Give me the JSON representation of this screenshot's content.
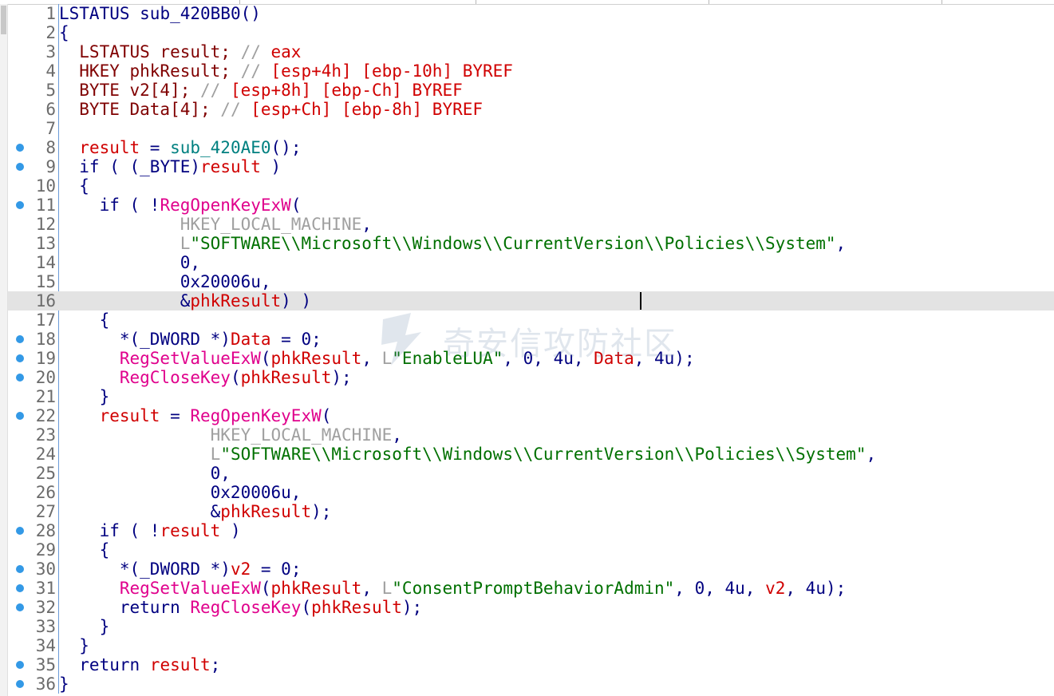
{
  "colors": {
    "keyword": "#000080",
    "type": "#800000",
    "variable": "#d00000",
    "function": "#e0008c",
    "local_function": "#008080",
    "string": "#007000",
    "number": "#000080",
    "comment": "#a0a0a0",
    "constant": "#a0a0a0",
    "line_number": "#6b6b6b",
    "breakpoint_dot": "#3399e6"
  },
  "watermark": {
    "text": "奇安信攻防社区"
  },
  "editor": {
    "current_line": 16,
    "lines": [
      {
        "n": "1",
        "dot": false,
        "tokens": [
          {
            "t": "LSTATUS",
            "c": "keyword"
          },
          {
            "t": " sub_420BB0()",
            "c": "keyword"
          }
        ]
      },
      {
        "n": "2",
        "dot": false,
        "tokens": [
          {
            "t": "{",
            "c": "keyword"
          }
        ]
      },
      {
        "n": "3",
        "dot": false,
        "tokens": [
          {
            "t": "  LSTATUS result; ",
            "c": "type"
          },
          {
            "t": "// ",
            "c": "comment"
          },
          {
            "t": "eax",
            "c": "variable"
          }
        ]
      },
      {
        "n": "4",
        "dot": false,
        "tokens": [
          {
            "t": "  HKEY phkResult; ",
            "c": "type"
          },
          {
            "t": "// ",
            "c": "comment"
          },
          {
            "t": "[esp+4h] [ebp-10h] BYREF",
            "c": "variable"
          }
        ]
      },
      {
        "n": "5",
        "dot": false,
        "tokens": [
          {
            "t": "  BYTE v2[4]; ",
            "c": "type"
          },
          {
            "t": "// ",
            "c": "comment"
          },
          {
            "t": "[esp+8h] [ebp-Ch] BYREF",
            "c": "variable"
          }
        ]
      },
      {
        "n": "6",
        "dot": false,
        "tokens": [
          {
            "t": "  BYTE Data[4]; ",
            "c": "type"
          },
          {
            "t": "// ",
            "c": "comment"
          },
          {
            "t": "[esp+Ch] [ebp-8h] BYREF",
            "c": "variable"
          }
        ]
      },
      {
        "n": "7",
        "dot": false,
        "tokens": []
      },
      {
        "n": "8",
        "dot": true,
        "tokens": [
          {
            "t": "  ",
            "c": "keyword"
          },
          {
            "t": "result",
            "c": "variable"
          },
          {
            "t": " = ",
            "c": "keyword"
          },
          {
            "t": "sub_420AE0",
            "c": "local_function"
          },
          {
            "t": "();",
            "c": "keyword"
          }
        ]
      },
      {
        "n": "9",
        "dot": true,
        "tokens": [
          {
            "t": "  if ( (",
            "c": "keyword"
          },
          {
            "t": "_BYTE",
            "c": "keyword"
          },
          {
            "t": ")",
            "c": "keyword"
          },
          {
            "t": "result",
            "c": "variable"
          },
          {
            "t": " )",
            "c": "keyword"
          }
        ]
      },
      {
        "n": "10",
        "dot": false,
        "tokens": [
          {
            "t": "  {",
            "c": "keyword"
          }
        ]
      },
      {
        "n": "11",
        "dot": true,
        "tokens": [
          {
            "t": "    if ( !",
            "c": "keyword"
          },
          {
            "t": "RegOpenKeyExW",
            "c": "function"
          },
          {
            "t": "(",
            "c": "keyword"
          }
        ]
      },
      {
        "n": "12",
        "dot": false,
        "tokens": [
          {
            "t": "            ",
            "c": "keyword"
          },
          {
            "t": "HKEY_LOCAL_MACHINE",
            "c": "constant"
          },
          {
            "t": ",",
            "c": "keyword"
          }
        ]
      },
      {
        "n": "13",
        "dot": false,
        "tokens": [
          {
            "t": "            ",
            "c": "keyword"
          },
          {
            "t": "L",
            "c": "comment"
          },
          {
            "t": "\"SOFTWARE\\\\Microsoft\\\\Windows\\\\CurrentVersion\\\\Policies\\\\System\"",
            "c": "string"
          },
          {
            "t": ",",
            "c": "keyword"
          }
        ]
      },
      {
        "n": "14",
        "dot": false,
        "tokens": [
          {
            "t": "            0,",
            "c": "number"
          }
        ]
      },
      {
        "n": "15",
        "dot": false,
        "tokens": [
          {
            "t": "            0x20006u,",
            "c": "number"
          }
        ]
      },
      {
        "n": "16",
        "dot": false,
        "tokens": [
          {
            "t": "            &",
            "c": "keyword"
          },
          {
            "t": "phkResult",
            "c": "variable"
          },
          {
            "t": ") )",
            "c": "keyword"
          }
        ]
      },
      {
        "n": "17",
        "dot": false,
        "tokens": [
          {
            "t": "    {",
            "c": "keyword"
          }
        ]
      },
      {
        "n": "18",
        "dot": true,
        "tokens": [
          {
            "t": "      *(",
            "c": "keyword"
          },
          {
            "t": "_DWORD",
            "c": "keyword"
          },
          {
            "t": " *)",
            "c": "keyword"
          },
          {
            "t": "Data",
            "c": "variable"
          },
          {
            "t": " = 0;",
            "c": "keyword"
          }
        ]
      },
      {
        "n": "19",
        "dot": true,
        "tokens": [
          {
            "t": "      ",
            "c": "keyword"
          },
          {
            "t": "RegSetValueExW",
            "c": "function"
          },
          {
            "t": "(",
            "c": "keyword"
          },
          {
            "t": "phkResult",
            "c": "variable"
          },
          {
            "t": ", ",
            "c": "keyword"
          },
          {
            "t": "L",
            "c": "comment"
          },
          {
            "t": "\"EnableLUA\"",
            "c": "string"
          },
          {
            "t": ", 0, 4u, ",
            "c": "keyword"
          },
          {
            "t": "Data",
            "c": "variable"
          },
          {
            "t": ", 4u);",
            "c": "keyword"
          }
        ]
      },
      {
        "n": "20",
        "dot": true,
        "tokens": [
          {
            "t": "      ",
            "c": "keyword"
          },
          {
            "t": "RegCloseKey",
            "c": "function"
          },
          {
            "t": "(",
            "c": "keyword"
          },
          {
            "t": "phkResult",
            "c": "variable"
          },
          {
            "t": ");",
            "c": "keyword"
          }
        ]
      },
      {
        "n": "21",
        "dot": false,
        "tokens": [
          {
            "t": "    }",
            "c": "keyword"
          }
        ]
      },
      {
        "n": "22",
        "dot": true,
        "tokens": [
          {
            "t": "    ",
            "c": "keyword"
          },
          {
            "t": "result",
            "c": "variable"
          },
          {
            "t": " = ",
            "c": "keyword"
          },
          {
            "t": "RegOpenKeyExW",
            "c": "function"
          },
          {
            "t": "(",
            "c": "keyword"
          }
        ]
      },
      {
        "n": "23",
        "dot": false,
        "tokens": [
          {
            "t": "               ",
            "c": "keyword"
          },
          {
            "t": "HKEY_LOCAL_MACHINE",
            "c": "constant"
          },
          {
            "t": ",",
            "c": "keyword"
          }
        ]
      },
      {
        "n": "24",
        "dot": false,
        "tokens": [
          {
            "t": "               ",
            "c": "keyword"
          },
          {
            "t": "L",
            "c": "comment"
          },
          {
            "t": "\"SOFTWARE\\\\Microsoft\\\\Windows\\\\CurrentVersion\\\\Policies\\\\System\"",
            "c": "string"
          },
          {
            "t": ",",
            "c": "keyword"
          }
        ]
      },
      {
        "n": "25",
        "dot": false,
        "tokens": [
          {
            "t": "               0,",
            "c": "number"
          }
        ]
      },
      {
        "n": "26",
        "dot": false,
        "tokens": [
          {
            "t": "               0x20006u,",
            "c": "number"
          }
        ]
      },
      {
        "n": "27",
        "dot": false,
        "tokens": [
          {
            "t": "               &",
            "c": "keyword"
          },
          {
            "t": "phkResult",
            "c": "variable"
          },
          {
            "t": ");",
            "c": "keyword"
          }
        ]
      },
      {
        "n": "28",
        "dot": true,
        "tokens": [
          {
            "t": "    if ( !",
            "c": "keyword"
          },
          {
            "t": "result",
            "c": "variable"
          },
          {
            "t": " )",
            "c": "keyword"
          }
        ]
      },
      {
        "n": "29",
        "dot": false,
        "tokens": [
          {
            "t": "    {",
            "c": "keyword"
          }
        ]
      },
      {
        "n": "30",
        "dot": true,
        "tokens": [
          {
            "t": "      *(",
            "c": "keyword"
          },
          {
            "t": "_DWORD",
            "c": "keyword"
          },
          {
            "t": " *)",
            "c": "keyword"
          },
          {
            "t": "v2",
            "c": "variable"
          },
          {
            "t": " = 0;",
            "c": "keyword"
          }
        ]
      },
      {
        "n": "31",
        "dot": true,
        "tokens": [
          {
            "t": "      ",
            "c": "keyword"
          },
          {
            "t": "RegSetValueExW",
            "c": "function"
          },
          {
            "t": "(",
            "c": "keyword"
          },
          {
            "t": "phkResult",
            "c": "variable"
          },
          {
            "t": ", ",
            "c": "keyword"
          },
          {
            "t": "L",
            "c": "comment"
          },
          {
            "t": "\"ConsentPromptBehaviorAdmin\"",
            "c": "string"
          },
          {
            "t": ", 0, 4u, ",
            "c": "keyword"
          },
          {
            "t": "v2",
            "c": "variable"
          },
          {
            "t": ", 4u);",
            "c": "keyword"
          }
        ]
      },
      {
        "n": "32",
        "dot": true,
        "tokens": [
          {
            "t": "      return ",
            "c": "keyword"
          },
          {
            "t": "RegCloseKey",
            "c": "function"
          },
          {
            "t": "(",
            "c": "keyword"
          },
          {
            "t": "phkResult",
            "c": "variable"
          },
          {
            "t": ");",
            "c": "keyword"
          }
        ]
      },
      {
        "n": "33",
        "dot": false,
        "tokens": [
          {
            "t": "    }",
            "c": "keyword"
          }
        ]
      },
      {
        "n": "34",
        "dot": false,
        "tokens": [
          {
            "t": "  }",
            "c": "keyword"
          }
        ]
      },
      {
        "n": "35",
        "dot": true,
        "tokens": [
          {
            "t": "  return ",
            "c": "keyword"
          },
          {
            "t": "result",
            "c": "variable"
          },
          {
            "t": ";",
            "c": "keyword"
          }
        ]
      },
      {
        "n": "36",
        "dot": true,
        "tokens": [
          {
            "t": "}",
            "c": "keyword"
          }
        ]
      }
    ]
  }
}
